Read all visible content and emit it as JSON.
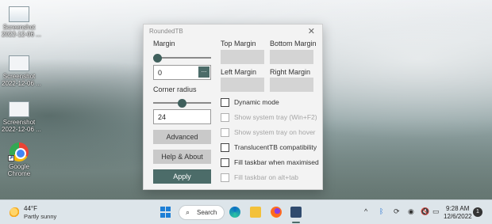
{
  "desktop": {
    "icons": [
      {
        "label_line1": "Screenshot",
        "label_line2": "2022-12-06 ..."
      },
      {
        "label_line1": "Screenshot",
        "label_line2": "2022-12-06 ..."
      },
      {
        "label_line1": "Screenshot",
        "label_line2": "2022-12-06 ..."
      },
      {
        "label_line1": "Google",
        "label_line2": "Chrome"
      }
    ]
  },
  "dialog": {
    "title": "RoundedTB",
    "close_glyph": "✕",
    "margin_label": "Margin",
    "margin_value": "0",
    "margin_slider_fraction": 0.0,
    "browse_label": "...",
    "corner_radius_label": "Corner radius",
    "corner_radius_value": "24",
    "corner_radius_slider_fraction": 0.5,
    "advanced_label": "Advanced",
    "help_label": "Help & About",
    "apply_label": "Apply",
    "top_margin_label": "Top Margin",
    "bottom_margin_label": "Bottom Margin",
    "left_margin_label": "Left Margin",
    "right_margin_label": "Right Margin",
    "options": [
      {
        "label": "Dynamic mode",
        "checked": false,
        "enabled": true
      },
      {
        "label": "Show system tray (Win+F2)",
        "checked": false,
        "enabled": false
      },
      {
        "label": "Show system tray on hover",
        "checked": false,
        "enabled": false
      },
      {
        "label": "TranslucentTB compatibility",
        "checked": false,
        "enabled": true
      },
      {
        "label": "Fill taskbar when maximised",
        "checked": false,
        "enabled": true
      },
      {
        "label": "Fill taskbar on alt+tab",
        "checked": false,
        "enabled": false
      }
    ],
    "accent_color": "#4c6c69"
  },
  "taskbar": {
    "weather_temp": "44°F",
    "weather_desc": "Partly sunny",
    "search_label": "Search",
    "tray": {
      "chevron": "^",
      "time": "9:28 AM",
      "date": "12/6/2022",
      "notification_count": "1"
    }
  }
}
